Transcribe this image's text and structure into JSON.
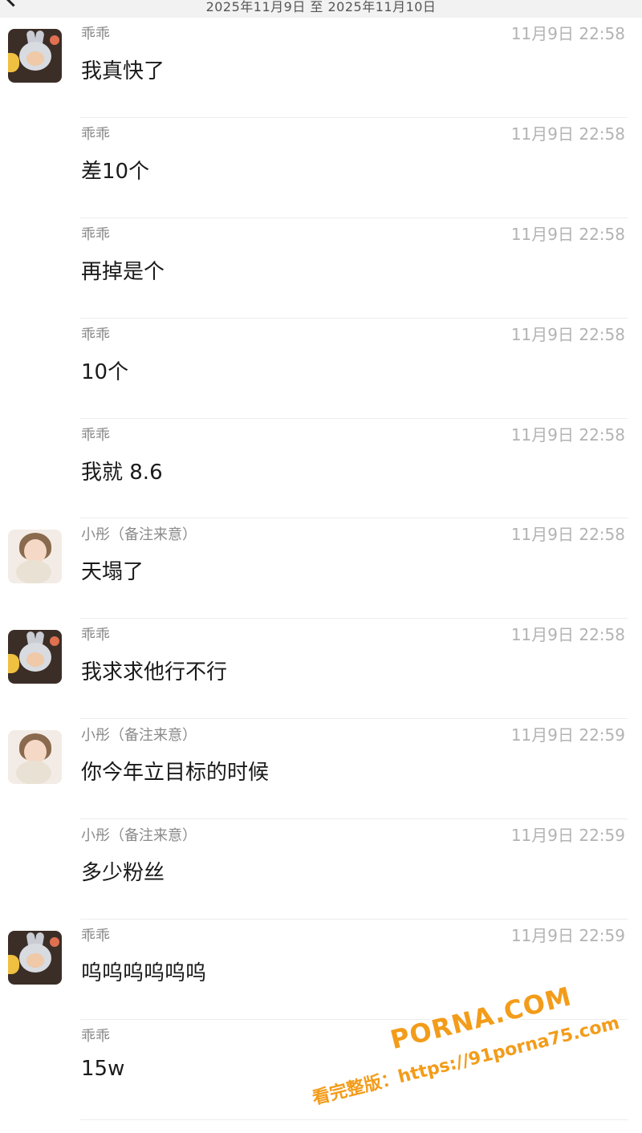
{
  "header": {
    "date_range": "2025年11月9日 至 2025年11月10日"
  },
  "messages": [
    {
      "sender": "乖乖",
      "time": "11月9日 22:58",
      "text": "我真快了",
      "avatar": "bunny"
    },
    {
      "sender": "乖乖",
      "time": "11月9日 22:58",
      "text": "差10个",
      "avatar": ""
    },
    {
      "sender": "乖乖",
      "time": "11月9日 22:58",
      "text": "再掉是个",
      "avatar": ""
    },
    {
      "sender": "乖乖",
      "time": "11月9日 22:58",
      "text": "10个",
      "avatar": ""
    },
    {
      "sender": "乖乖",
      "time": "11月9日 22:58",
      "text": "我就 8.6",
      "avatar": ""
    },
    {
      "sender": "小彤（备注来意）",
      "time": "11月9日 22:58",
      "text": "天塌了",
      "avatar": "girl"
    },
    {
      "sender": "乖乖",
      "time": "11月9日 22:58",
      "text": "我求求他行不行",
      "avatar": "bunny"
    },
    {
      "sender": "小彤（备注来意）",
      "time": "11月9日 22:59",
      "text": "你今年立目标的时候",
      "avatar": "girl"
    },
    {
      "sender": "小彤（备注来意）",
      "time": "11月9日 22:59",
      "text": "多少粉丝",
      "avatar": ""
    },
    {
      "sender": "乖乖",
      "time": "11月9日 22:59",
      "text": "呜呜呜呜呜呜",
      "avatar": "bunny"
    },
    {
      "sender": "乖乖",
      "time": "",
      "text": "15w",
      "avatar": ""
    }
  ],
  "watermark": {
    "main": "PORNA.COM",
    "sub": "看完整版：https://91porna75.com"
  },
  "colors": {
    "background": "#ffffff",
    "header_bg": "#f2f2f2",
    "name": "#8a8a8a",
    "time": "#b3b3b3",
    "text": "#1a1a1a",
    "watermark": "#f39c1a"
  }
}
